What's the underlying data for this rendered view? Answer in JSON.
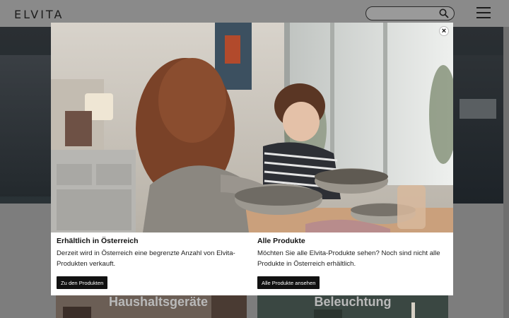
{
  "header": {
    "logo": "ELVITA",
    "search_placeholder": ""
  },
  "categories": [
    {
      "label": "Haushaltsgeräte"
    },
    {
      "label": "Beleuchtung"
    }
  ],
  "modal": {
    "photo_alt": "Zwei Kinder backen in einer Küche",
    "left": {
      "title": "Erhältlich in Österreich",
      "text": "Derzeit wird in Österreich eine begrenzte Anzahl von Elvita-Produkten verkauft.",
      "button": "Zu den Produkten"
    },
    "right": {
      "title": "Alle Produkte",
      "text": "Möchten Sie alle Elvita-Produkte sehen? Noch sind nicht alle Produkte in Österreich erhältlich.",
      "button": "Alle Produkte ansehen"
    },
    "close_symbol": "×"
  },
  "colors": {
    "overlay": "#7d7d7d",
    "button_bg": "#111111",
    "modal_bg": "#ffffff"
  }
}
